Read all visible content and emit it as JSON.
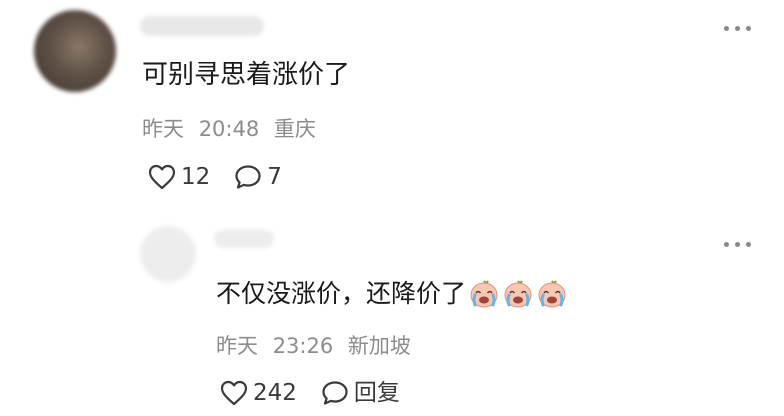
{
  "comment": {
    "text": "可别寻思着涨价了",
    "date": "昨天",
    "time": "20:48",
    "location": "重庆",
    "likes": "12",
    "replies": "7",
    "icons": {
      "avatar": "avatar-blurred",
      "like": "heart-outline-icon",
      "reply": "speech-bubble-icon",
      "more": "more-dots-icon"
    }
  },
  "reply": {
    "text": "不仅没涨价，还降价了",
    "emoji": "crying-face-emoji",
    "emoji_count": 3,
    "date": "昨天",
    "time": "23:26",
    "location": "新加坡",
    "likes": "242",
    "reply_label": "回复",
    "icons": {
      "avatar": "avatar-blurred",
      "like": "heart-outline-icon",
      "reply": "speech-bubble-icon",
      "more": "more-dots-icon"
    }
  },
  "colors": {
    "text": "#1a1a1a",
    "meta": "#8c8c8c",
    "action": "#3a3a3a",
    "background": "#ffffff"
  }
}
